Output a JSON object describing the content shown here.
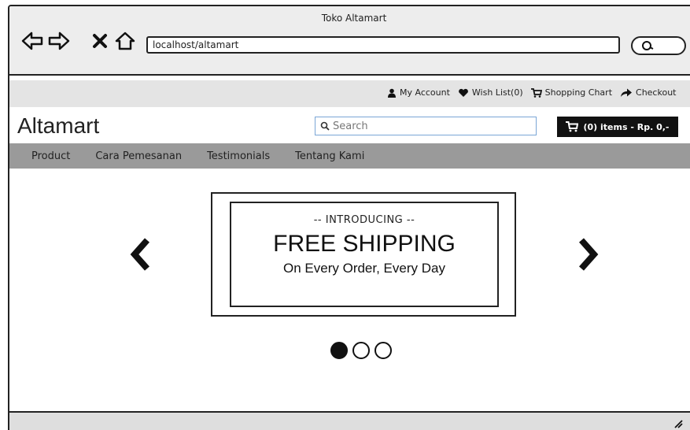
{
  "window": {
    "title": "Toko Altamart",
    "address": "localhost/altamart"
  },
  "browser_controls": {
    "back_icon": "arrow-left-outline-icon",
    "forward_icon": "arrow-right-outline-icon",
    "stop_icon": "close-icon",
    "home_icon": "home-outline-icon",
    "search_icon": "search-icon"
  },
  "topbar": {
    "links": [
      {
        "label": "My Account",
        "icon": "user-icon"
      },
      {
        "label": "Wish List(0)",
        "icon": "heart-icon"
      },
      {
        "label": "Shopping Chart",
        "icon": "cart-icon"
      },
      {
        "label": "Checkout",
        "icon": "share-arrow-icon"
      }
    ]
  },
  "header": {
    "logo": "Altamart",
    "search_placeholder": "Search",
    "cart_label": "(0) items - Rp. 0,-"
  },
  "menu": {
    "items": [
      "Product",
      "Cara Pemesanan",
      "Testimonials",
      "Tentang Kami"
    ]
  },
  "carousel": {
    "kicker": "-- INTRODUCING --",
    "title": "FREE SHIPPING",
    "subtitle": "On Every Order, Every Day",
    "active_index": 0,
    "slide_count": 3
  }
}
